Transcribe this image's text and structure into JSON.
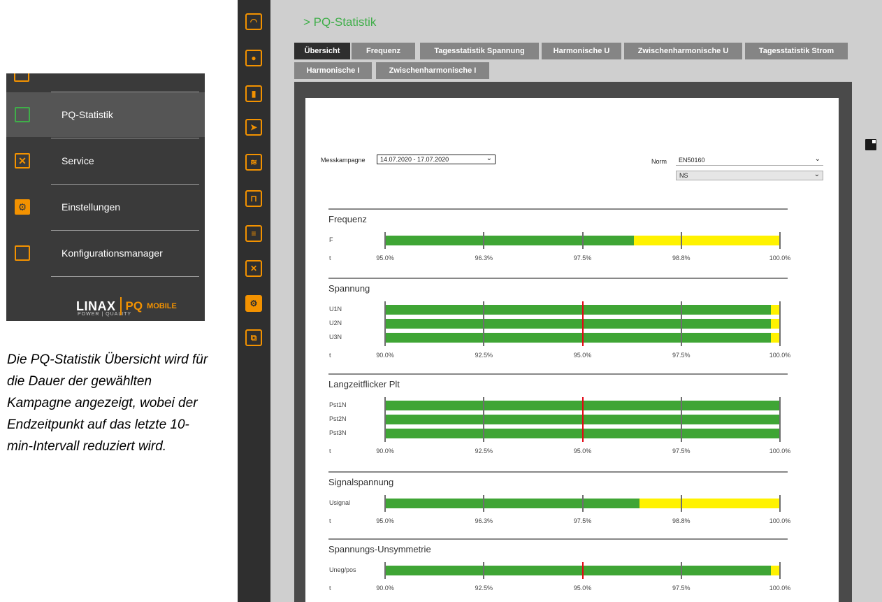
{
  "sidebar": {
    "items": [
      {
        "label": "PQ-Statistik",
        "icon": "report-icon",
        "active": true
      },
      {
        "label": "Service",
        "icon": "tools-icon",
        "active": false
      },
      {
        "label": "Einstellungen",
        "icon": "gear-icon",
        "active": false
      },
      {
        "label": "Konfigurationsmanager",
        "icon": "config-copy-icon",
        "active": false
      }
    ],
    "brand": {
      "name": "LINAX",
      "product": "PQ",
      "product_suffix": "MOBILE",
      "tagline": "POWER | QUALITY"
    }
  },
  "caption": "Die PQ-Statistik Übersicht wird für die Dauer der gewählten Kampagne angezeigt, wobei der Endzeitpunkt auf das letzte 10-min-Intervall reduziert wird.",
  "rail_icons": [
    "dashboard-icon",
    "meter-icon",
    "bar-chart-icon",
    "phasor-icon",
    "harmonics-icon",
    "waveform-icon",
    "report-icon",
    "tools-icon",
    "gear-icon",
    "config-copy-icon"
  ],
  "header": {
    "title": "> PQ-Statistik"
  },
  "tabs": [
    {
      "label": "Übersicht",
      "active": true
    },
    {
      "label": "Frequenz"
    },
    {
      "label": "Tagesstatistik Spannung"
    },
    {
      "label": "Harmonische U"
    },
    {
      "label": "Zwischenharmonische U"
    },
    {
      "label": "Tagesstatistik Strom"
    },
    {
      "label": "Harmonische I"
    },
    {
      "label": "Zwischenharmonische I"
    }
  ],
  "filters": {
    "campaign_label": "Messkampagne",
    "campaign_value": "14.07.2020 - 17.07.2020",
    "norm_label": "Norm",
    "norm_value": "EN50160",
    "network_value": "NS"
  },
  "colors": {
    "ok": "#3fa535",
    "warn": "#fff200",
    "limit": "#e30613",
    "accent": "#f39200",
    "title_green": "#3fae49"
  },
  "sections": [
    {
      "title": "Frequenz",
      "axis_name": "t",
      "axis": [
        "95.0%",
        "96.3%",
        "97.5%",
        "98.8%",
        "100.0%"
      ],
      "limit_line": null,
      "rows": [
        {
          "label": "F",
          "green_fraction": 0.63
        }
      ]
    },
    {
      "title": "Spannung",
      "axis_name": "t",
      "axis": [
        "90.0%",
        "92.5%",
        "95.0%",
        "97.5%",
        "100.0%"
      ],
      "limit_line": 2,
      "rows": [
        {
          "label": "U1N",
          "green_fraction": 0.977
        },
        {
          "label": "U2N",
          "green_fraction": 0.977
        },
        {
          "label": "U3N",
          "green_fraction": 0.977
        }
      ]
    },
    {
      "title": "Langzeitflicker Plt",
      "axis_name": "t",
      "axis": [
        "90.0%",
        "92.5%",
        "95.0%",
        "97.5%",
        "100.0%"
      ],
      "limit_line": 2,
      "rows": [
        {
          "label": "Pst1N",
          "green_fraction": 1.0
        },
        {
          "label": "Pst2N",
          "green_fraction": 1.0
        },
        {
          "label": "Pst3N",
          "green_fraction": 1.0
        }
      ]
    },
    {
      "title": "Signalspannung",
      "axis_name": "t",
      "axis": [
        "95.0%",
        "96.3%",
        "97.5%",
        "98.8%",
        "100.0%"
      ],
      "limit_line": null,
      "rows": [
        {
          "label": "Usignal",
          "green_fraction": 0.645
        }
      ]
    },
    {
      "title": "Spannungs-Unsymmetrie",
      "axis_name": "t",
      "axis": [
        "90.0%",
        "92.5%",
        "95.0%",
        "97.5%",
        "100.0%"
      ],
      "limit_line": 2,
      "rows": [
        {
          "label": "Uneg/pos",
          "green_fraction": 0.977
        }
      ]
    }
  ]
}
